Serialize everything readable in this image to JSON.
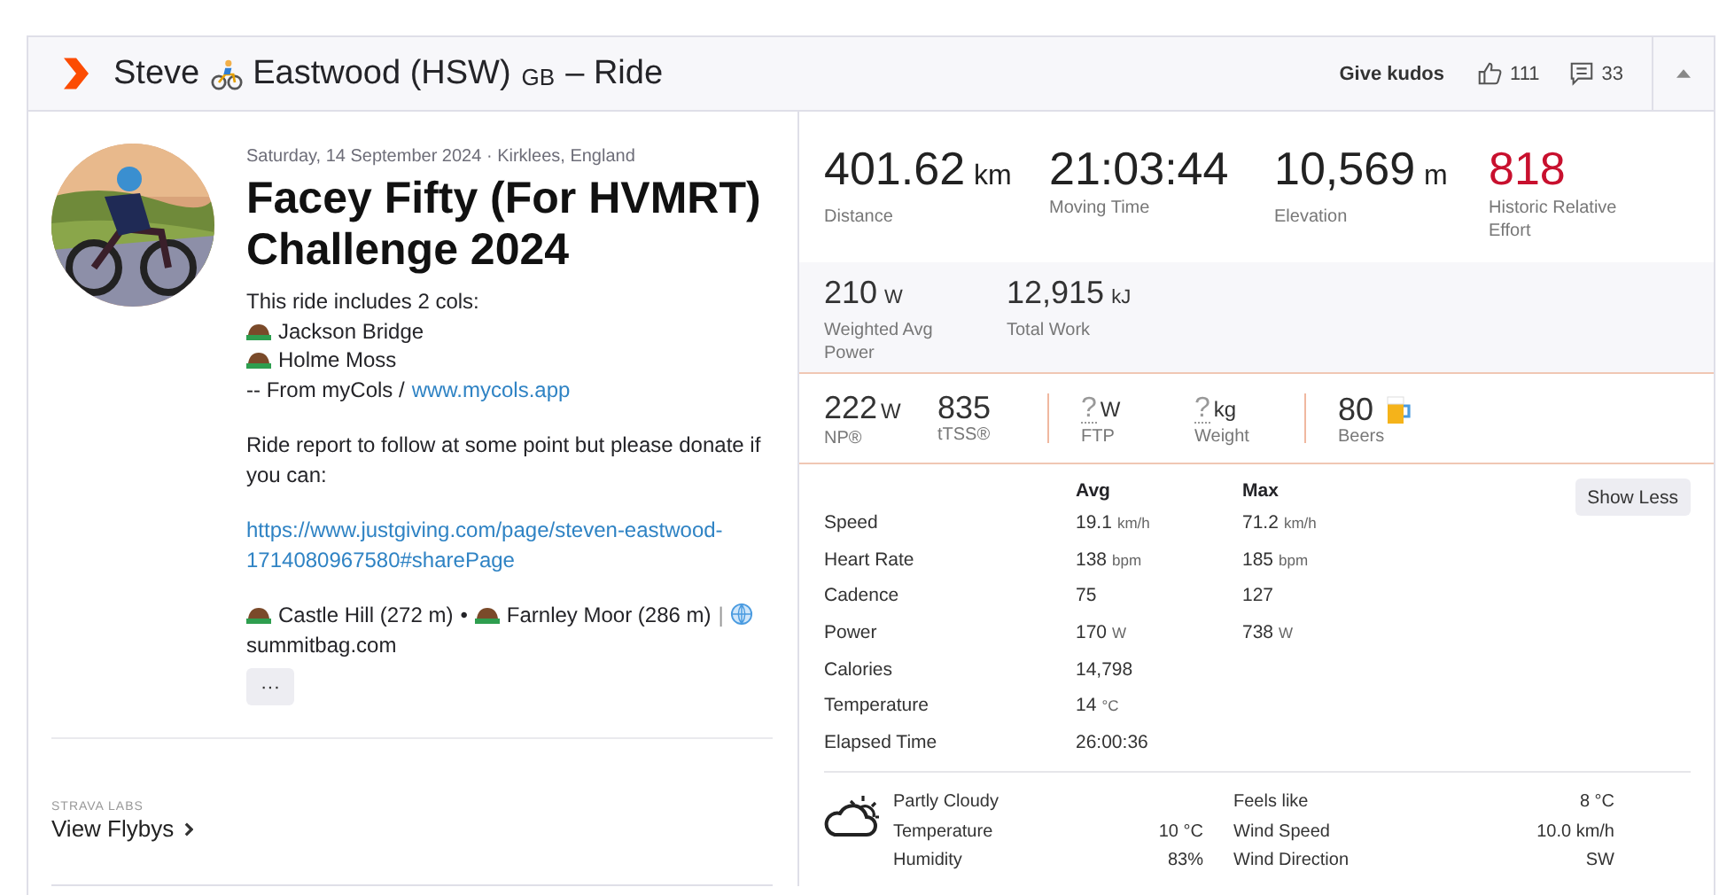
{
  "header": {
    "name_first": "Steve",
    "name_last": "Eastwood (HSW)",
    "country": "GB",
    "activity": "– Ride",
    "kudos_label": "Give kudos",
    "kudos_count": "111",
    "comment_count": "33"
  },
  "activity": {
    "meta": "Saturday, 14 September 2024 · Kirklees, England",
    "title": "Facey Fifty (For HVMRT) Challenge 2024",
    "description": [
      {
        "kind": "text",
        "text": "This ride includes 2 cols:"
      },
      {
        "kind": "col",
        "text": "Jackson Bridge"
      },
      {
        "kind": "col",
        "text": "Holme Moss"
      },
      {
        "kind": "source",
        "text": "-- From myCols / ",
        "link": "www.mycols.app"
      },
      {
        "kind": "paragraph",
        "text": "Ride report to follow at some point but please donate if you can:"
      },
      {
        "kind": "link",
        "text": "https://www.justgiving.com/page/steven-eastwood-1714080967580#sharePage"
      },
      {
        "kind": "summits",
        "items": [
          "Castle Hill (272 m)",
          "Farnley Moor (286 m)"
        ],
        "separator": "•",
        "site_separator": "|",
        "site": "summitbag.com"
      }
    ],
    "more_button": "···"
  },
  "labs": {
    "tag": "STRAVA LABS",
    "link": "View Flybys"
  },
  "primary_stats": [
    {
      "kind": "stat",
      "value": "401.62",
      "unit": "km",
      "label": "Distance"
    },
    {
      "kind": "stat",
      "value": "21:03:44",
      "label": "Moving Time"
    },
    {
      "kind": "stat",
      "value": "10,569",
      "unit": "m",
      "label": "Elevation"
    },
    {
      "kind": "effort",
      "value": "818",
      "label": "Historic Relative Effort"
    }
  ],
  "secondary_stats": [
    {
      "value": "210",
      "unit": "W",
      "label": "Weighted Avg Power"
    },
    {
      "value": "12,915",
      "unit": "kJ",
      "label": "Total Work"
    }
  ],
  "extension_groups": [
    [
      {
        "kind": "known",
        "value": "222",
        "unit": "W",
        "label": "NP®"
      },
      {
        "kind": "known",
        "value": "835",
        "label": "tTSS®"
      }
    ],
    [
      {
        "kind": "unknown",
        "value": "?",
        "unit": "W",
        "label": "FTP"
      },
      {
        "kind": "unknown",
        "value": "?",
        "unit": "kg",
        "label": "Weight"
      }
    ],
    [
      {
        "kind": "beer",
        "value": "80",
        "label": "Beers"
      }
    ]
  ],
  "details": {
    "columns": [
      "Avg",
      "Max"
    ],
    "toggle_button": "Show Less",
    "rows": [
      {
        "label": "Speed",
        "avg": "19.1",
        "avg_unit": "km/h",
        "max": "71.2",
        "max_unit": "km/h"
      },
      {
        "label": "Heart Rate",
        "avg": "138",
        "avg_unit": "bpm",
        "max": "185",
        "max_unit": "bpm"
      },
      {
        "label": "Cadence",
        "avg": "75",
        "max": "127"
      },
      {
        "label": "Power",
        "avg": "170",
        "avg_unit": "W",
        "max": "738",
        "max_unit": "W"
      },
      {
        "label": "Calories",
        "avg": "14,798"
      },
      {
        "label": "Temperature",
        "avg": "14",
        "avg_unit": "°C"
      },
      {
        "label": "Elapsed Time",
        "avg": "26:00:36"
      }
    ]
  },
  "weather": {
    "condition": "Partly Cloudy",
    "left": [
      {
        "label": "Temperature",
        "value": "10 °C"
      },
      {
        "label": "Humidity",
        "value": "83%"
      }
    ],
    "right": [
      {
        "label": "Feels like",
        "value": "8 °C"
      },
      {
        "label": "Wind Speed",
        "value": "10.0 km/h"
      },
      {
        "label": "Wind Direction",
        "value": "SW"
      }
    ]
  }
}
